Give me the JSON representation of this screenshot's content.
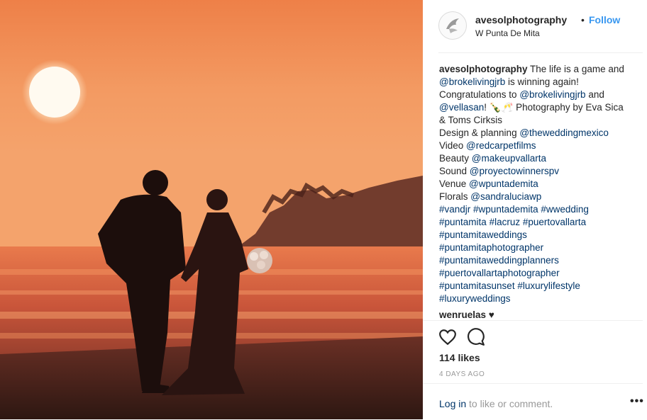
{
  "post": {
    "username": "avesolphotography",
    "separator": "•",
    "follow_label": "Follow",
    "location": "W Punta De Mita"
  },
  "caption": {
    "username": "avesolphotography",
    "lines": [
      [
        {
          "t": "text",
          "v": " The life is a game and"
        }
      ],
      [
        {
          "t": "link",
          "v": "@brokelivingjrb"
        },
        {
          "t": "text",
          "v": " is winning again!"
        }
      ],
      [
        {
          "t": "text",
          "v": "Congratulations to "
        },
        {
          "t": "link",
          "v": "@brokelivingjrb"
        },
        {
          "t": "text",
          "v": " and"
        }
      ],
      [
        {
          "t": "link",
          "v": "@vellasan"
        },
        {
          "t": "text",
          "v": "! 🍾🥂 Photography by Eva Sica"
        }
      ],
      [
        {
          "t": "text",
          "v": "& Toms Cirksis"
        }
      ],
      [
        {
          "t": "text",
          "v": "Design & planning "
        },
        {
          "t": "link",
          "v": "@theweddingmexico"
        }
      ],
      [
        {
          "t": "text",
          "v": "Video "
        },
        {
          "t": "link",
          "v": "@redcarpetfilms"
        }
      ],
      [
        {
          "t": "text",
          "v": "Beauty "
        },
        {
          "t": "link",
          "v": "@makeupvallarta"
        }
      ],
      [
        {
          "t": "text",
          "v": "Sound "
        },
        {
          "t": "link",
          "v": "@proyectowinnerspv"
        }
      ],
      [
        {
          "t": "text",
          "v": "Venue "
        },
        {
          "t": "link",
          "v": "@wpuntademita"
        }
      ],
      [
        {
          "t": "text",
          "v": "Florals "
        },
        {
          "t": "link",
          "v": "@sandraluciawp"
        }
      ],
      [
        {
          "t": "link",
          "v": "#vandjr"
        },
        {
          "t": "text",
          "v": " "
        },
        {
          "t": "link",
          "v": "#wpuntademita"
        },
        {
          "t": "text",
          "v": " "
        },
        {
          "t": "link",
          "v": "#wwedding"
        }
      ],
      [
        {
          "t": "link",
          "v": "#puntamita"
        },
        {
          "t": "text",
          "v": " "
        },
        {
          "t": "link",
          "v": "#lacruz"
        },
        {
          "t": "text",
          "v": " "
        },
        {
          "t": "link",
          "v": "#puertovallarta"
        }
      ],
      [
        {
          "t": "link",
          "v": "#puntamitaweddings"
        }
      ],
      [
        {
          "t": "link",
          "v": "#puntamitaphotographer"
        }
      ],
      [
        {
          "t": "link",
          "v": "#puntamitaweddingplanners"
        }
      ],
      [
        {
          "t": "link",
          "v": "#puertovallartaphotographer"
        }
      ],
      [
        {
          "t": "link",
          "v": "#puntamitasunset"
        },
        {
          "t": "text",
          "v": " "
        },
        {
          "t": "link",
          "v": "#luxurylifestyle"
        }
      ],
      [
        {
          "t": "link",
          "v": "#luxuryweddings"
        }
      ]
    ]
  },
  "comment": {
    "username": "wenruelas",
    "text": " ♥"
  },
  "actions": {
    "heart_icon": "heart-outline-icon",
    "comment_icon": "comment-bubble-icon",
    "likes": "114 likes",
    "time": "4 DAYS AGO"
  },
  "footer": {
    "login_link": "Log in",
    "login_rest": " to like or comment.",
    "more": "•••"
  },
  "colors": {
    "link": "#003569",
    "follow": "#3897f0",
    "muted": "#999999",
    "sky_top": "#f08a4f",
    "sky_mid": "#f5a06a",
    "horizon": "#e8603a"
  }
}
